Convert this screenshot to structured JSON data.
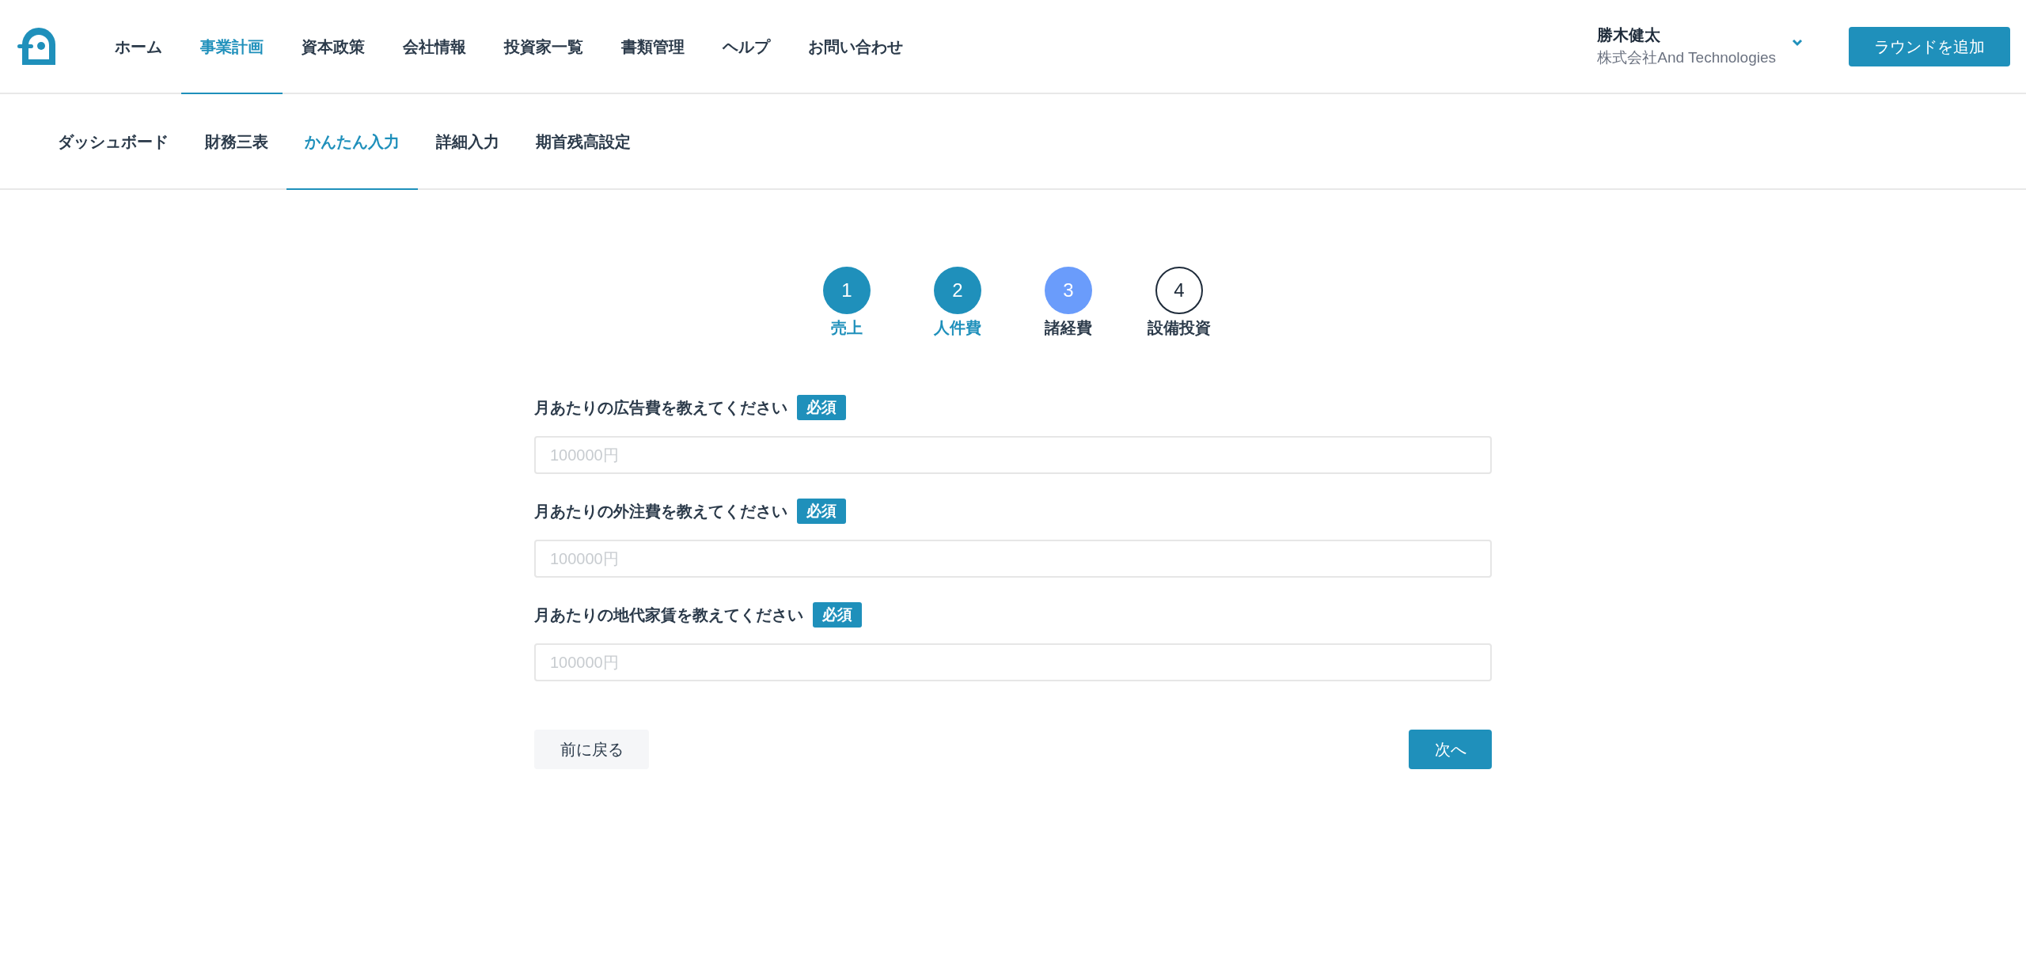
{
  "nav": {
    "items": [
      {
        "label": "ホーム",
        "selected": false
      },
      {
        "label": "事業計画",
        "selected": true
      },
      {
        "label": "資本政策",
        "selected": false
      },
      {
        "label": "会社情報",
        "selected": false
      },
      {
        "label": "投資家一覧",
        "selected": false
      },
      {
        "label": "書類管理",
        "selected": false
      },
      {
        "label": "ヘルプ",
        "selected": false
      },
      {
        "label": "お問い合わせ",
        "selected": false
      }
    ],
    "user": {
      "name": "勝木健太",
      "company": "株式会社And Technologies"
    },
    "add_button": "ラウンドを追加"
  },
  "subnav": {
    "items": [
      {
        "label": "ダッシュボード",
        "selected": false
      },
      {
        "label": "財務三表",
        "selected": false
      },
      {
        "label": "かんたん入力",
        "selected": true
      },
      {
        "label": "詳細入力",
        "selected": false
      },
      {
        "label": "期首残高設定",
        "selected": false
      }
    ]
  },
  "steps": [
    {
      "number": "1",
      "label": "売上",
      "kind": "done"
    },
    {
      "number": "2",
      "label": "人件費",
      "kind": "done"
    },
    {
      "number": "3",
      "label": "諸経費",
      "kind": "current"
    },
    {
      "number": "4",
      "label": "設備投資",
      "kind": "upcoming"
    }
  ],
  "fields": [
    {
      "label": "月あたりの広告費を教えてください",
      "badge": "必須",
      "placeholder": "100000円"
    },
    {
      "label": "月あたりの外注費を教えてください",
      "badge": "必須",
      "placeholder": "100000円"
    },
    {
      "label": "月あたりの地代家賃を教えてください",
      "badge": "必須",
      "placeholder": "100000円"
    }
  ],
  "back_button": "前に戻る",
  "next_button": "次へ"
}
